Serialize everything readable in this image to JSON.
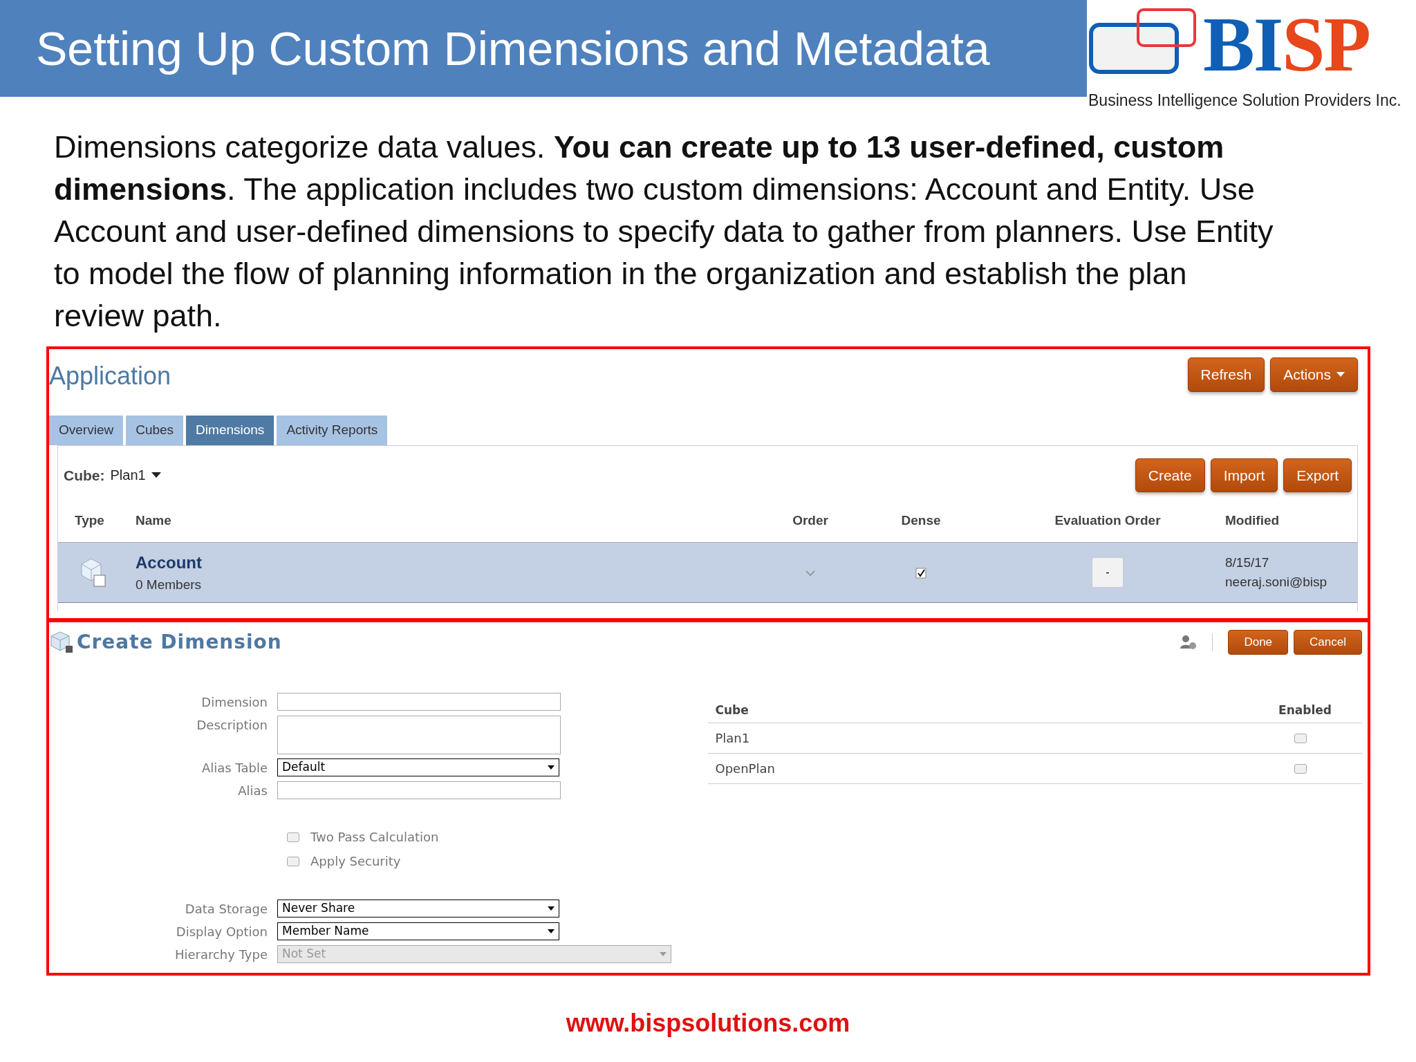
{
  "slide": {
    "title": "Setting Up Custom Dimensions and Metadata",
    "logo": {
      "wordmark_blue": "BI",
      "wordmark_red": "SP",
      "tagline": "Business Intelligence Solution Providers Inc."
    },
    "paragraph": "Dimensions categorize data values. **You can create up to 13 user-defined, custom dimensions**. The application includes two custom dimensions: Account and Entity. Use Account and user-defined dimensions to specify data to gather from planners. Use Entity to model the flow of planning information in the organization and establish the plan review path.",
    "footer_link": "www.bispsolutions.com"
  },
  "application": {
    "title": "Application",
    "buttons": [
      {
        "label": "Refresh",
        "kind": "button"
      },
      {
        "label": "Actions",
        "kind": "menu"
      }
    ],
    "tabs": [
      {
        "label": "Overview",
        "selected": false
      },
      {
        "label": "Cubes",
        "selected": false
      },
      {
        "label": "Dimensions",
        "selected": true
      },
      {
        "label": "Activity Reports",
        "selected": false
      }
    ],
    "cube_label": "Cube:",
    "cube_value": "Plan1",
    "toolbar_buttons": [
      "Create",
      "Import",
      "Export"
    ],
    "table": {
      "columns": [
        "Type",
        "Name",
        "Order",
        "Dense",
        "Evaluation Order",
        "Modified"
      ],
      "rows": [
        {
          "name": "Account",
          "members": "0 Members",
          "selected": true,
          "dense": true,
          "evaluation_order": "-",
          "modified_date": "8/15/17",
          "modified_by": "neeraj.soni@bisp"
        }
      ]
    }
  },
  "create_dimension": {
    "title": "Create Dimension",
    "buttons": [
      "Done",
      "Cancel"
    ],
    "fields": [
      {
        "label": "Dimension",
        "kind": "text"
      },
      {
        "label": "Description",
        "kind": "textarea"
      },
      {
        "label": "Alias Table",
        "kind": "select",
        "value": "Default"
      },
      {
        "label": "Alias",
        "kind": "text"
      }
    ],
    "checkboxes": [
      {
        "label": "Two Pass Calculation",
        "checked": false
      },
      {
        "label": "Apply Security",
        "checked": false
      }
    ],
    "selects": [
      {
        "label": "Data Storage",
        "value": "Never Share",
        "disabled": false
      },
      {
        "label": "Display Option",
        "value": "Member Name",
        "disabled": false
      },
      {
        "label": "Hierarchy Type",
        "value": "Not Set",
        "disabled": true
      }
    ],
    "cube_table": {
      "columns": [
        "Cube",
        "Enabled"
      ],
      "rows": [
        {
          "cube": "Plan1",
          "enabled": false
        },
        {
          "cube": "OpenPlan",
          "enabled": false
        }
      ]
    }
  }
}
